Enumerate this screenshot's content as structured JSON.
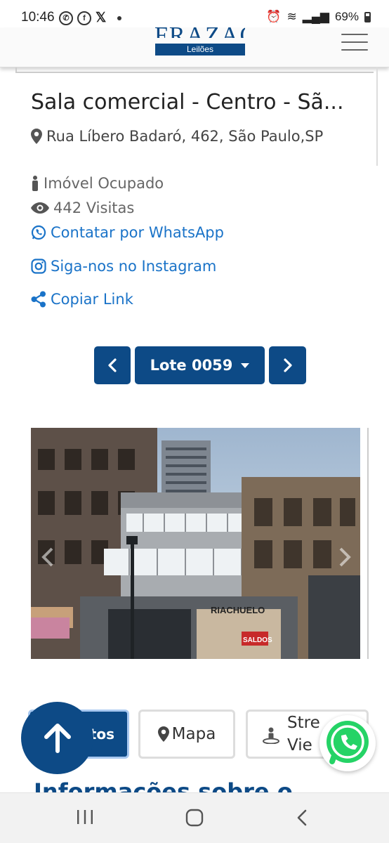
{
  "status_bar": {
    "time": "10:46",
    "battery": "69%"
  },
  "header": {
    "logo_word": "FRAZAO",
    "logo_sub": "Leilões"
  },
  "listing": {
    "title": "Sala comercial - Centro - Sã...",
    "address": "Rua Líbero Badaró, 462, São Paulo,SP",
    "occupancy": "Imóvel Ocupado",
    "visits": "442 Visitas",
    "whatsapp_link": "Contatar por WhatsApp",
    "instagram_link": "Siga-nos no Instagram",
    "copy_link": "Copiar Link"
  },
  "lot_nav": {
    "selected": "Lote 0059"
  },
  "photo": {
    "sign_text": "RIACHUELO",
    "sale_text": "SALDOS"
  },
  "tabs": {
    "fotos": "tos",
    "mapa": "Mapa",
    "street_line1": "Stre",
    "street_line2": "Vie"
  },
  "section": {
    "heading": "Informações sobre o"
  },
  "colors": {
    "brand": "#0d4a86",
    "link": "#1a73c8",
    "whatsapp": "#25d366"
  }
}
